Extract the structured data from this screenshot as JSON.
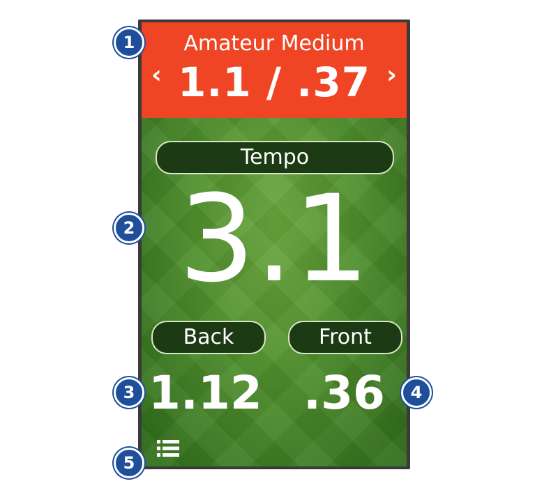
{
  "header": {
    "title": "Amateur Medium",
    "value": "1.1 / .37",
    "prev": "‹",
    "next": "›",
    "color": "#f04524"
  },
  "tempo": {
    "label": "Tempo",
    "value": "3.1"
  },
  "back": {
    "label": "Back",
    "value": "1.12"
  },
  "front": {
    "label": "Front",
    "value": ".36"
  },
  "menu": {
    "icon": "list-icon"
  },
  "callouts": [
    "1",
    "2",
    "3",
    "4",
    "5"
  ],
  "colors": {
    "callout": "#1f4f9b",
    "field": "#4e8e2c",
    "pill": "#1c3a14"
  }
}
